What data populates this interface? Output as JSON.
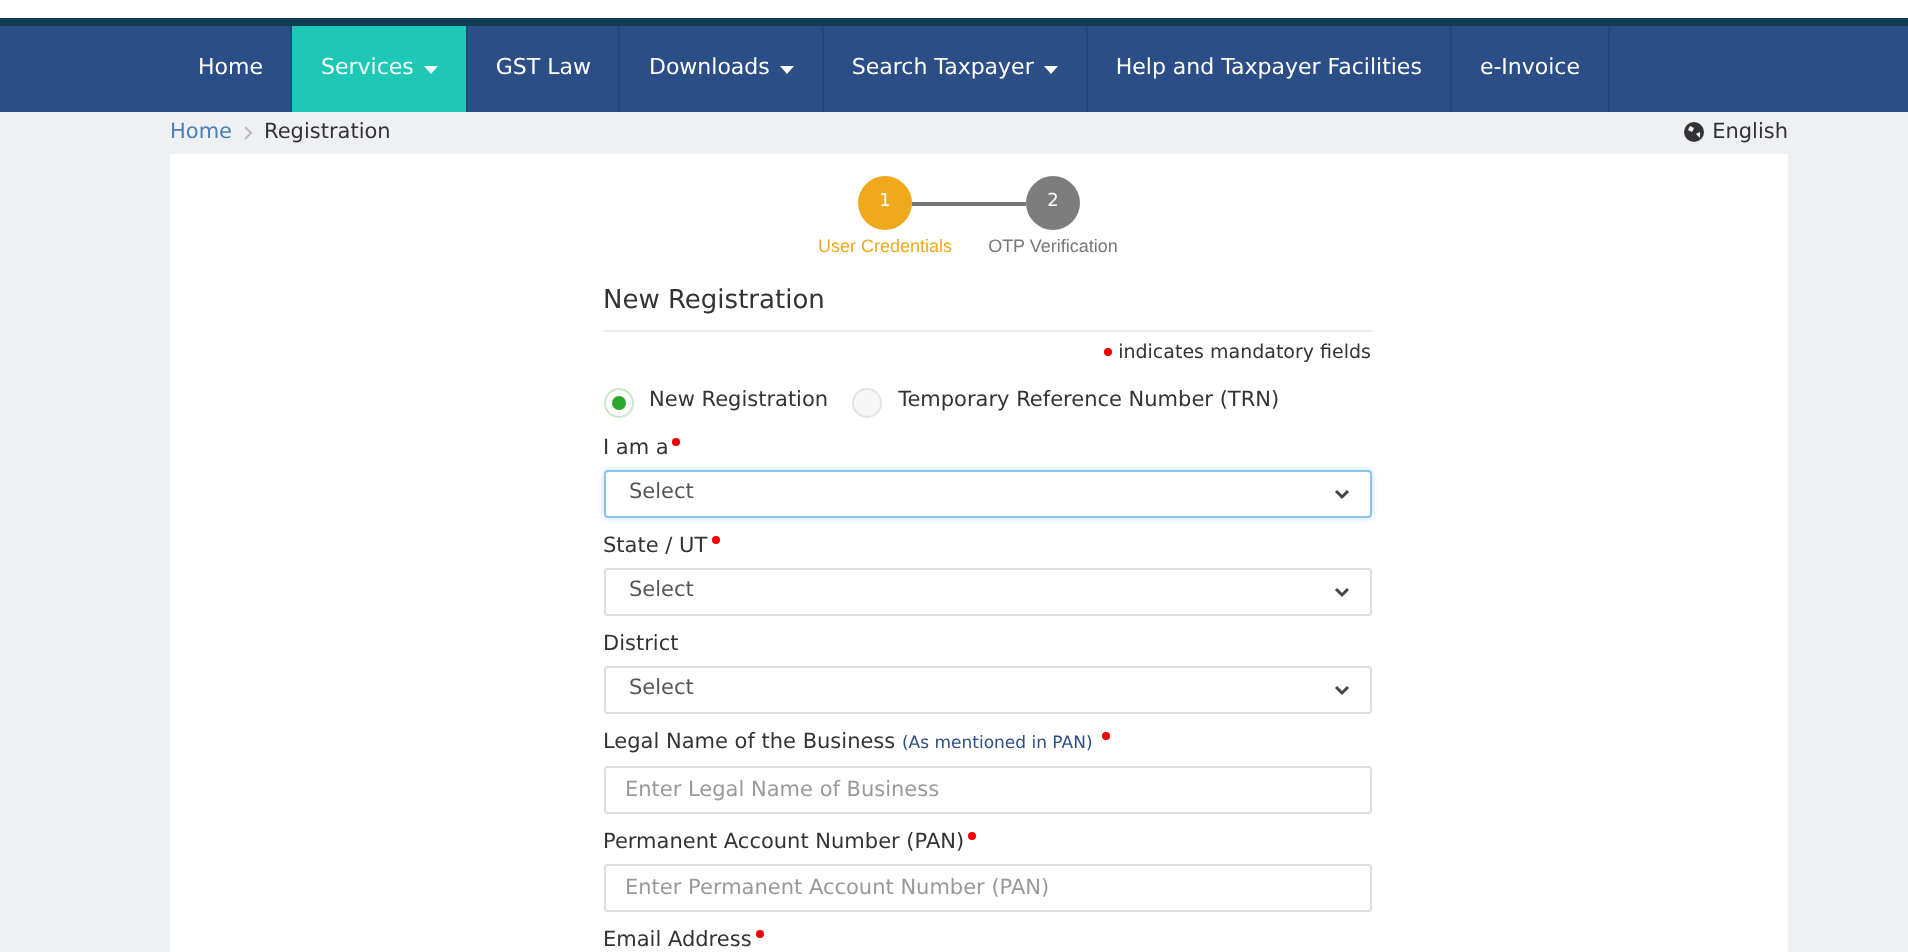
{
  "nav": [
    {
      "label": "Home",
      "dropdown": false,
      "selected": false
    },
    {
      "label": "Services",
      "dropdown": true,
      "selected": true
    },
    {
      "label": "GST Law",
      "dropdown": false,
      "selected": false
    },
    {
      "label": "Downloads",
      "dropdown": true,
      "selected": false
    },
    {
      "label": "Search Taxpayer",
      "dropdown": true,
      "selected": false
    },
    {
      "label": "Help and Taxpayer Facilities",
      "dropdown": false,
      "selected": false
    },
    {
      "label": "e-Invoice",
      "dropdown": false,
      "selected": false
    }
  ],
  "breadcrumb": [
    {
      "label": "Home",
      "link": true
    },
    {
      "label": "Registration",
      "link": false
    }
  ],
  "language": "English",
  "steps": [
    {
      "number": "1",
      "label": "User Credentials",
      "active": true
    },
    {
      "number": "2",
      "label": "OTP Verification",
      "active": false
    }
  ],
  "form": {
    "title": "New Registration",
    "mandatory_note": "indicates mandatory fields",
    "options": [
      {
        "label": "New Registration",
        "selected": true
      },
      {
        "label": "Temporary Reference Number (TRN)",
        "selected": false
      }
    ],
    "fields": [
      {
        "kind": "select",
        "label": "I am a",
        "required": true,
        "value": "Select",
        "focused": true
      },
      {
        "kind": "select",
        "label": "State / UT",
        "required": true,
        "value": "Select",
        "focused": false
      },
      {
        "kind": "select",
        "label": "District",
        "required": false,
        "value": "Select",
        "focused": false
      },
      {
        "kind": "input",
        "label": "Legal Name of the Business",
        "note": "(As mentioned in PAN)",
        "required": true,
        "placeholder": "Enter Legal Name of Business",
        "focused": false
      },
      {
        "kind": "input",
        "label": "Permanent Account Number (PAN)",
        "required": true,
        "placeholder": "Enter Permanent Account Number (PAN)",
        "focused": false
      },
      {
        "kind": "label",
        "label": "Email Address",
        "required": true
      }
    ]
  }
}
